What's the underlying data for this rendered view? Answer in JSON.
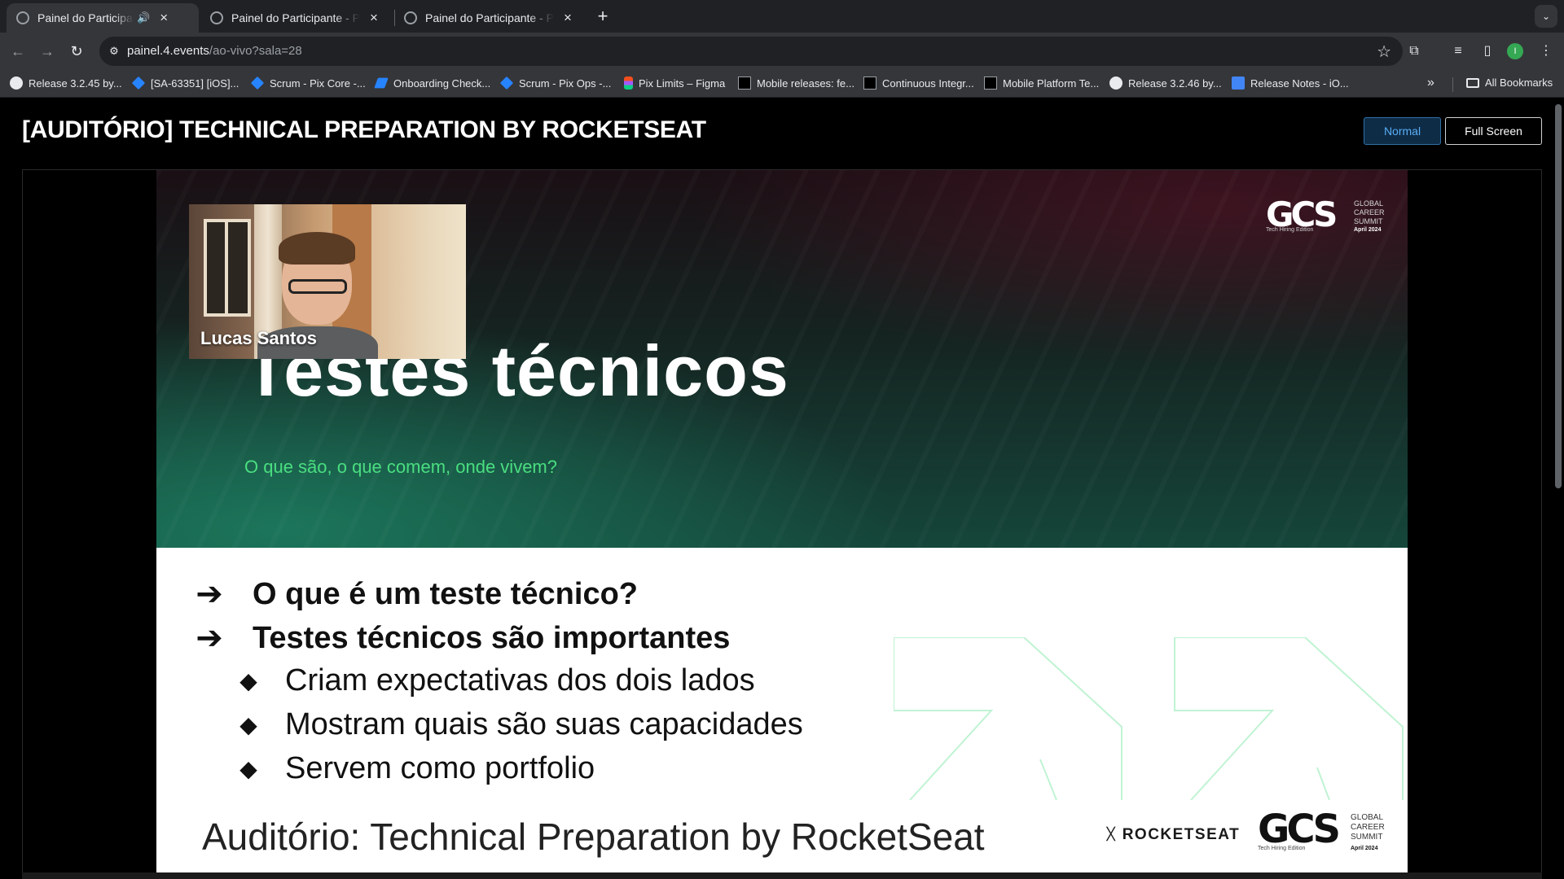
{
  "tabs": [
    {
      "title": "Painel do Participante - PowerEvents",
      "active": true,
      "audio": true
    },
    {
      "title": "Painel do Participante - PowerEvents",
      "active": false
    },
    {
      "title": "Painel do Participante - PowerEvents",
      "active": false
    }
  ],
  "icons": {
    "audio": "🔊",
    "close": "×",
    "new_tab": "+",
    "tab_search": "⌄",
    "back": "←",
    "forward": "→",
    "reload": "↻",
    "site_info": "⚙",
    "star": "☆",
    "extensions": "⧉",
    "media": "≡",
    "side_panel": "▯",
    "menu": "⋮",
    "overflow": "»",
    "rocketseat_mark": "ᚷ",
    "arrow_bullet": "➔",
    "diamond_bullet": "◆"
  },
  "address_bar": {
    "host": "painel.4.events",
    "path": "/ao-vivo?sala=28"
  },
  "profile_initial": "I",
  "bookmarks": [
    {
      "label": "Release 3.2.45 by...",
      "icon": "github-icon"
    },
    {
      "label": "[SA-63351] [iOS]...",
      "icon": "jira-icon"
    },
    {
      "label": "Scrum - Pix Core -...",
      "icon": "jira-icon"
    },
    {
      "label": "Onboarding Check...",
      "icon": "confluence-icon"
    },
    {
      "label": "Scrum - Pix Ops -...",
      "icon": "jira-icon"
    },
    {
      "label": "Pix Limits – Figma",
      "icon": "figma-icon"
    },
    {
      "label": "Mobile releases: fe...",
      "icon": "pix-icon"
    },
    {
      "label": "Continuous Integr...",
      "icon": "pix-icon"
    },
    {
      "label": "Mobile Platform Te...",
      "icon": "pix-icon"
    },
    {
      "label": "Release 3.2.46 by...",
      "icon": "github-icon"
    },
    {
      "label": "Release Notes - iO...",
      "icon": "docs-icon"
    }
  ],
  "all_bookmarks_label": "All Bookmarks",
  "page": {
    "title": "[AUDITÓRIO] TECHNICAL PREPARATION BY ROCKETSEAT",
    "normal_button": "Normal",
    "fullscreen_button": "Full Screen"
  },
  "slide": {
    "speaker_name": "Lucas Santos",
    "heading": "Testes técnicos",
    "subheading": "O que são, o que comem, onde vivem?",
    "logo": {
      "mark": "GCS",
      "words": [
        "GLOBAL",
        "CAREER",
        "SUMMIT"
      ],
      "edition": "Tech Hiring Edition",
      "date": "April 2024"
    },
    "bullets": [
      {
        "level": 1,
        "text": "O que é um teste técnico?"
      },
      {
        "level": 1,
        "text": "Testes técnicos são importantes"
      },
      {
        "level": 2,
        "text": "Criam expectativas dos dois lados"
      },
      {
        "level": 2,
        "text": "Mostram quais são suas capacidades"
      },
      {
        "level": 2,
        "text": "Servem como portfolio"
      }
    ],
    "footer": "Auditório: Technical Preparation by RocketSeat",
    "sponsor": "ROCKETSEAT"
  },
  "colors": {
    "accent_green": "#4ade80",
    "button_blue": "#58aef5",
    "chrome_dark": "#202124",
    "chrome_toolbar": "#35363a"
  }
}
